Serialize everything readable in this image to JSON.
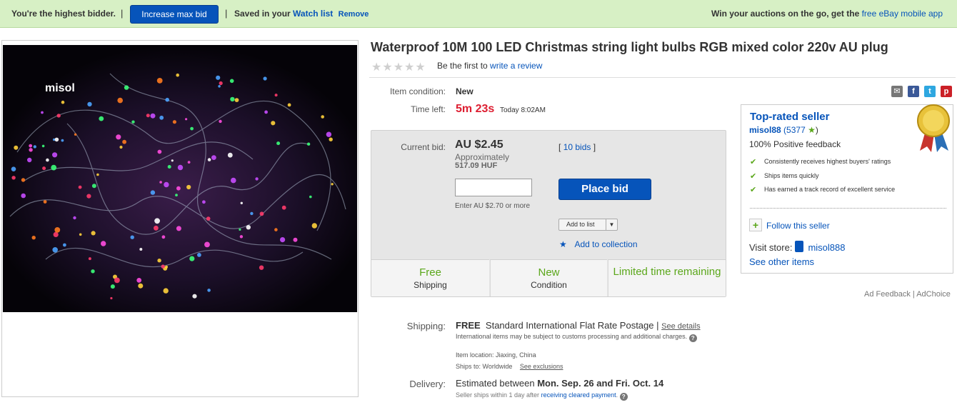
{
  "topbar": {
    "status": "You're the highest bidder.",
    "separator": "|",
    "increase_button": "Increase max bid",
    "saved_prefix": "Saved in your",
    "watch_list": "Watch list",
    "remove": "Remove",
    "mobile_text": "Win your auctions on the go, get the",
    "mobile_link": "free eBay mobile app"
  },
  "image": {
    "watermark": "misol"
  },
  "item": {
    "title": "Waterproof 10M 100 LED Christmas string light bulbs RGB mixed color 220v AU plug",
    "stars": "★★★★★",
    "review_prefix": "Be the first to",
    "review_link": "write a review",
    "condition_label": "Item condition:",
    "condition_value": "New",
    "time_label": "Time left:",
    "time_value": "5m 23s",
    "time_today": "Today 8:02AM"
  },
  "share": {
    "email_icon": "email-icon",
    "facebook_icon": "facebook-icon",
    "twitter_icon": "twitter-icon",
    "pinterest_icon": "pinterest-icon"
  },
  "bid": {
    "current_label": "Current bid:",
    "price": "AU $2.45",
    "approx": "Approximately",
    "huf": "517.09 HUF",
    "bids_open": "[",
    "bids_link": "10 bids",
    "bids_close": "]",
    "input_value": "",
    "enter_hint": "Enter AU $2.70 or more",
    "place_bid": "Place bid",
    "add_to_list": "Add to list",
    "add_to_collection": "Add to collection"
  },
  "features": [
    {
      "big": "Free",
      "small": "Shipping"
    },
    {
      "big": "New",
      "small": "Condition"
    },
    {
      "big": "Limited time remaining",
      "small": ""
    }
  ],
  "seller": {
    "badge": "Top-rated seller",
    "name": "misol88",
    "feedback_count": "(5377",
    "feedback_close": ")",
    "positive": "100% Positive feedback",
    "checks": [
      "Consistently receives highest buyers' ratings",
      "Ships items quickly",
      "Has earned a track record of excellent service"
    ],
    "follow": "Follow this seller",
    "visit_label": "Visit store:",
    "store_name": "misol888",
    "see_other": "See other items"
  },
  "ads": {
    "feedback": "Ad Feedback",
    "sep": "|",
    "adchoice": "AdChoice"
  },
  "shipping": {
    "label": "Shipping:",
    "free": "FREE",
    "method": "Standard International Flat Rate Postage",
    "sep": "|",
    "see_details": "See details",
    "note": "International items may be subject to customs processing and additional charges.",
    "location_label": "Item location:",
    "location": "Jiaxing, China",
    "ships_to_label": "Ships to:",
    "ships_to": "Worldwide",
    "see_exclusions": "See exclusions"
  },
  "delivery": {
    "label": "Delivery:",
    "prefix": "Estimated between",
    "dates": "Mon. Sep. 26 and Fri. Oct. 14",
    "note_prefix": "Seller ships within 1 day after",
    "note_link": "receiving cleared payment",
    "note_suffix": "."
  },
  "colors": {
    "accent": "#0654ba",
    "topbar_bg": "#d7f0c5",
    "time_red": "#dd1e31",
    "green": "#5ba71b"
  }
}
